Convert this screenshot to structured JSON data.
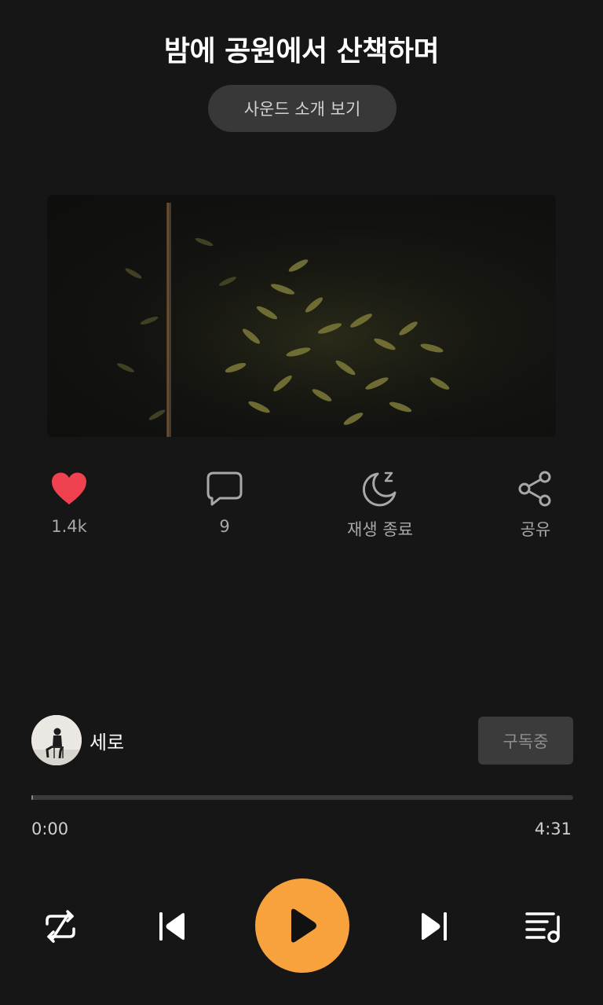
{
  "header": {
    "title": "밤에 공원에서 산책하며",
    "intro_button": "사운드 소개 보기"
  },
  "cover": {
    "icon": "cover-image"
  },
  "actions": [
    {
      "icon": "heart-icon",
      "label": "1.4k",
      "active": true,
      "color": "#ef4150"
    },
    {
      "icon": "comment-icon",
      "label": "9"
    },
    {
      "icon": "sleep-timer-icon",
      "label": "재생 종료"
    },
    {
      "icon": "share-icon",
      "label": "공유"
    }
  ],
  "creator": {
    "name": "세로",
    "subscribe_label": "구독중"
  },
  "player": {
    "current_time": "0:00",
    "total_time": "4:31",
    "progress": 0.0,
    "controls": [
      "repeat-icon",
      "previous-icon",
      "play-icon",
      "next-icon",
      "playlist-icon"
    ],
    "accent": "#f7a23c"
  }
}
